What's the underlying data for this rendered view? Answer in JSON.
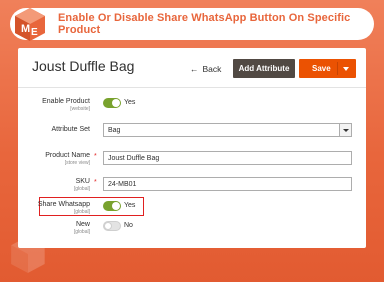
{
  "banner": {
    "title": "Enable Or Disable Share WhatsApp Button On Specific Product",
    "logo_icon": "cube-logo-icon"
  },
  "header": {
    "product_title": "Joust Duffle Bag",
    "back_label": "Back",
    "add_attribute_label": "Add Attribute",
    "save_label": "Save"
  },
  "form": {
    "enable_product": {
      "label": "Enable Product",
      "scope": "[website]",
      "state": "Yes",
      "on": true
    },
    "attribute_set": {
      "label": "Attribute Set",
      "value": "Bag"
    },
    "product_name": {
      "label": "Product Name",
      "scope": "[store view]",
      "value": "Joust Duffle Bag",
      "required": "*"
    },
    "sku": {
      "label": "SKU",
      "scope": "[global]",
      "value": "24-MB01",
      "required": "*"
    },
    "share_whatsapp": {
      "label": "Share Whatsapp",
      "scope": "[global]",
      "state": "Yes",
      "on": true
    },
    "new": {
      "label": "New",
      "scope": "[global]",
      "state": "No",
      "on": false
    }
  },
  "colors": {
    "background": "#e8663c",
    "accent": "#eb5202",
    "toggle_on": "#79a22e",
    "highlight": "#e02020"
  }
}
